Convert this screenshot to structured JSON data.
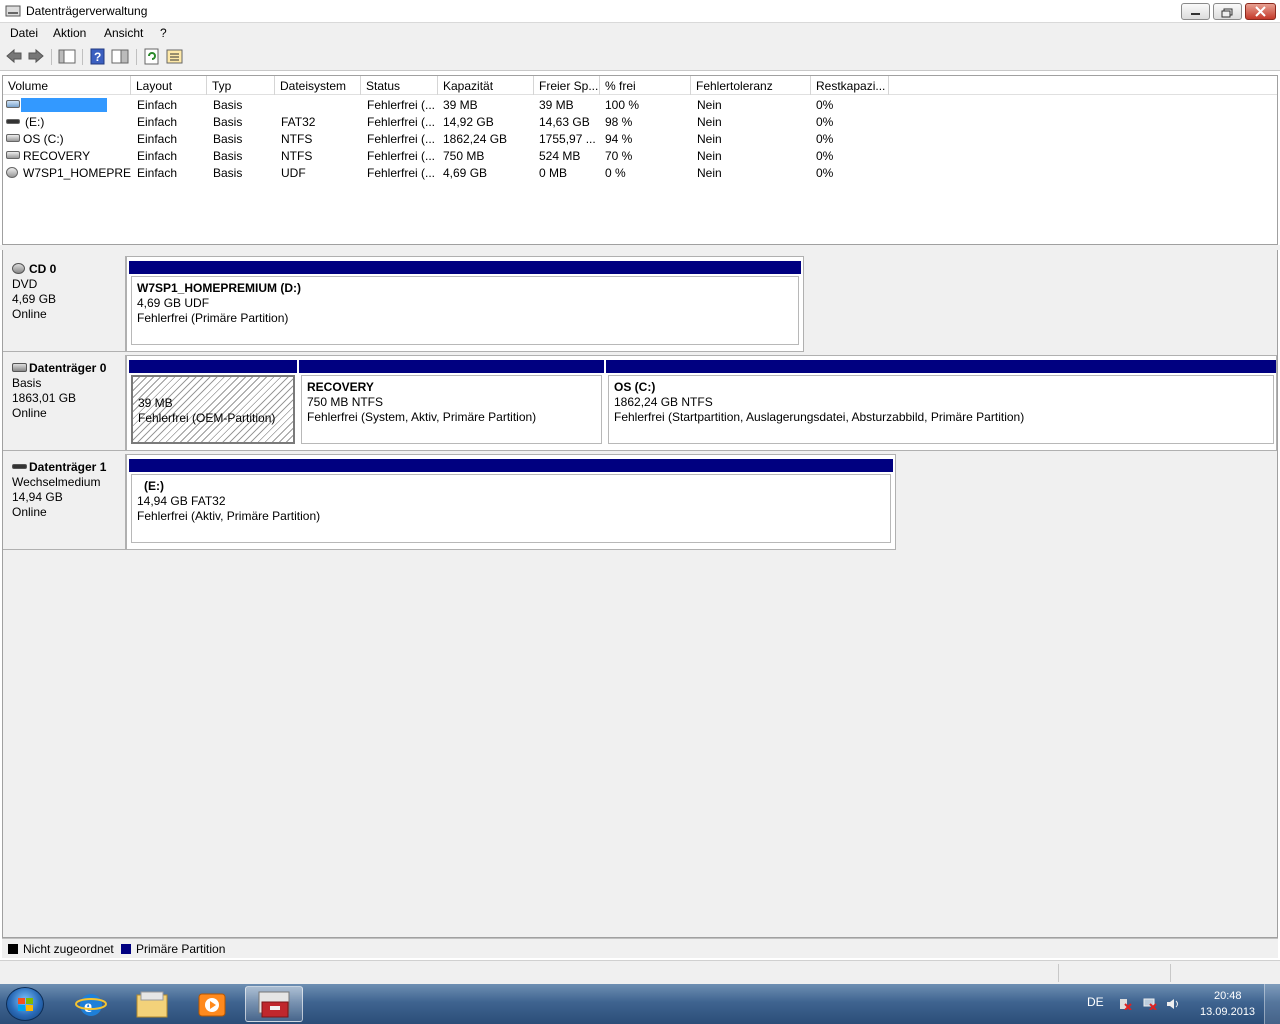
{
  "window": {
    "title": "Datenträgerverwaltung"
  },
  "menu": {
    "items": [
      "Datei",
      "Aktion",
      "Ansicht",
      "?"
    ]
  },
  "toolbar": {
    "icons": [
      "back-arrow-icon",
      "forward-arrow-icon",
      "console-tree-icon",
      "help-icon",
      "properties-icon",
      "refresh-icon",
      "settings-icon"
    ]
  },
  "volume_list": {
    "columns": [
      "Volume",
      "Layout",
      "Typ",
      "Dateisystem",
      "Status",
      "Kapazität",
      "Freier Sp...",
      "% frei",
      "Fehlertoleranz",
      "Restkapazi..."
    ],
    "rows": [
      {
        "volume": "",
        "layout": "Einfach",
        "typ": "Basis",
        "fs": "",
        "status": "Fehlerfrei (...",
        "cap": "39 MB",
        "free": "39 MB",
        "pct": "100 %",
        "ft": "Nein",
        "rest": "0%"
      },
      {
        "volume": "(E:)",
        "layout": "Einfach",
        "typ": "Basis",
        "fs": "FAT32",
        "status": "Fehlerfrei (...",
        "cap": "14,92 GB",
        "free": "14,63 GB",
        "pct": "98 %",
        "ft": "Nein",
        "rest": "0%"
      },
      {
        "volume": "OS (C:)",
        "layout": "Einfach",
        "typ": "Basis",
        "fs": "NTFS",
        "status": "Fehlerfrei (...",
        "cap": "1862,24 GB",
        "free": "1755,97 ...",
        "pct": "94 %",
        "ft": "Nein",
        "rest": "0%"
      },
      {
        "volume": "RECOVERY",
        "layout": "Einfach",
        "typ": "Basis",
        "fs": "NTFS",
        "status": "Fehlerfrei (...",
        "cap": "750 MB",
        "free": "524 MB",
        "pct": "70 %",
        "ft": "Nein",
        "rest": "0%"
      },
      {
        "volume": "W7SP1_HOMEPRE...",
        "layout": "Einfach",
        "typ": "Basis",
        "fs": "UDF",
        "status": "Fehlerfrei (...",
        "cap": "4,69 GB",
        "free": "0 MB",
        "pct": "0 %",
        "ft": "Nein",
        "rest": "0%"
      }
    ]
  },
  "disks": [
    {
      "name": "CD 0",
      "type": "DVD",
      "size": "4,69 GB",
      "state": "Online",
      "partitions": [
        {
          "name": "W7SP1_HOMEPREMIUM  (D:)",
          "size": "4,69 GB UDF",
          "status": "Fehlerfrei (Primäre Partition)"
        }
      ]
    },
    {
      "name": "Datenträger 0",
      "type": "Basis",
      "size": "1863,01 GB",
      "state": "Online",
      "partitions": [
        {
          "name": "",
          "size": "39 MB",
          "status": "Fehlerfrei (OEM-Partition)"
        },
        {
          "name": "RECOVERY",
          "size": "750 MB NTFS",
          "status": "Fehlerfrei (System, Aktiv, Primäre Partition)"
        },
        {
          "name": "OS  (C:)",
          "size": "1862,24 GB NTFS",
          "status": "Fehlerfrei (Startpartition, Auslagerungsdatei, Absturzabbild, Primäre Partition)"
        }
      ]
    },
    {
      "name": "Datenträger 1",
      "type": "Wechselmedium",
      "size": "14,94 GB",
      "state": "Online",
      "partitions": [
        {
          "name": "(E:)",
          "size": "14,94 GB FAT32",
          "status": "Fehlerfrei (Aktiv, Primäre Partition)"
        }
      ]
    }
  ],
  "legend": {
    "unallocated": "Nicht zugeordnet",
    "primary": "Primäre Partition",
    "unallocated_color": "#000000",
    "primary_color": "#000080"
  },
  "taskbar": {
    "lang": "DE",
    "time": "20:48",
    "date": "13.09.2013",
    "apps": [
      "internet-explorer-icon",
      "explorer-folder-icon",
      "media-player-icon",
      "computer-management-icon"
    ]
  }
}
